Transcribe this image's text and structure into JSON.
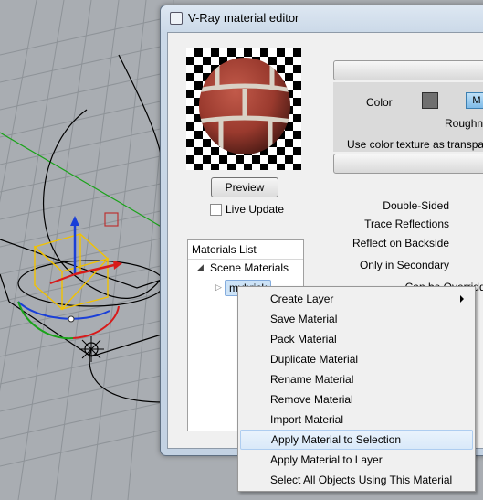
{
  "window": {
    "title": "V-Ray material editor"
  },
  "preview": {
    "button_label": "Preview",
    "live_update_label": "Live Update",
    "live_update_checked": false
  },
  "materials_list": {
    "header": "Materials List",
    "scene_label": "Scene Materials",
    "selected_material": "mybrick"
  },
  "properties": {
    "color_label": "Color",
    "color_swatch": "#707070",
    "map_button_label": "M",
    "roughness_label": "Roughne",
    "use_color_texture_label": "Use color texture as transparen",
    "options": [
      "Double-Sided",
      "Trace Reflections",
      "Reflect on Backside",
      "Only in Secondary",
      "Can be Overridden"
    ]
  },
  "context_menu": {
    "items": [
      {
        "label": "Create Layer",
        "has_submenu": true
      },
      {
        "label": "Save Material"
      },
      {
        "label": "Pack Material"
      },
      {
        "label": "Duplicate Material"
      },
      {
        "label": "Rename Material"
      },
      {
        "label": "Remove Material"
      },
      {
        "label": "Import Material"
      },
      {
        "label": "Apply Material to Selection",
        "highlighted": true
      },
      {
        "label": "Apply Material to Layer"
      },
      {
        "label": "Select All Objects Using This Material"
      }
    ]
  },
  "colors": {
    "accent": "#84acdd",
    "menu_highlight": "#d9e9f9",
    "brick": "#9a3a2e"
  }
}
